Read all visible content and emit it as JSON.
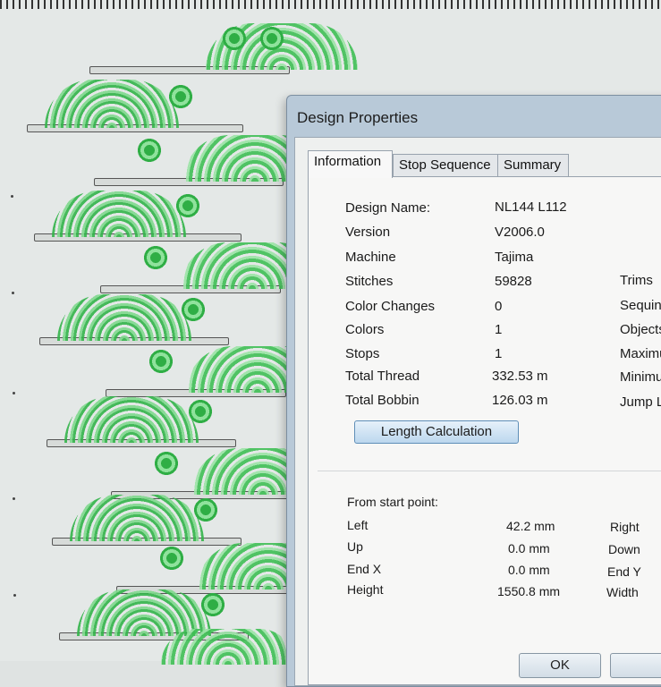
{
  "dialog": {
    "title": "Design Properties",
    "tabs": [
      {
        "label": "Information",
        "active": true
      },
      {
        "label": "Stop Sequence",
        "active": false
      },
      {
        "label": "Summary",
        "active": false
      }
    ],
    "info": [
      {
        "label": "Design Name:",
        "value": "NL144 L112"
      },
      {
        "label": "Version",
        "value": "V2006.0"
      },
      {
        "label": "Machine",
        "value": "Tajima"
      },
      {
        "label": "Stitches",
        "value": "59828"
      },
      {
        "label": "Color Changes",
        "value": "0"
      },
      {
        "label": "Colors",
        "value": "1"
      },
      {
        "label": "Stops",
        "value": "1"
      },
      {
        "label": "Total Thread",
        "value": "332.53 m"
      },
      {
        "label": "Total Bobbin",
        "value": "126.03 m"
      }
    ],
    "right_labels": [
      "Trims",
      "Sequins",
      "Objects",
      "Maximum",
      "Minimum",
      "Jump Le"
    ],
    "length_button": "Length Calculation",
    "from_start": {
      "heading": "From start point:",
      "rows": [
        {
          "label": "Left",
          "value": "42.2 mm",
          "right": "Right"
        },
        {
          "label": "Up",
          "value": "0.0 mm",
          "right": "Down"
        },
        {
          "label": "End X",
          "value": "0.0 mm",
          "right": "End Y"
        },
        {
          "label": "Height",
          "value": "1550.8 mm",
          "right": "Width"
        }
      ]
    },
    "ok_label": "OK"
  },
  "colors": {
    "stitch_green": "#3fbf55",
    "dialog_frame": "#b8c9d8",
    "button_accent": "#5f8fb8"
  }
}
